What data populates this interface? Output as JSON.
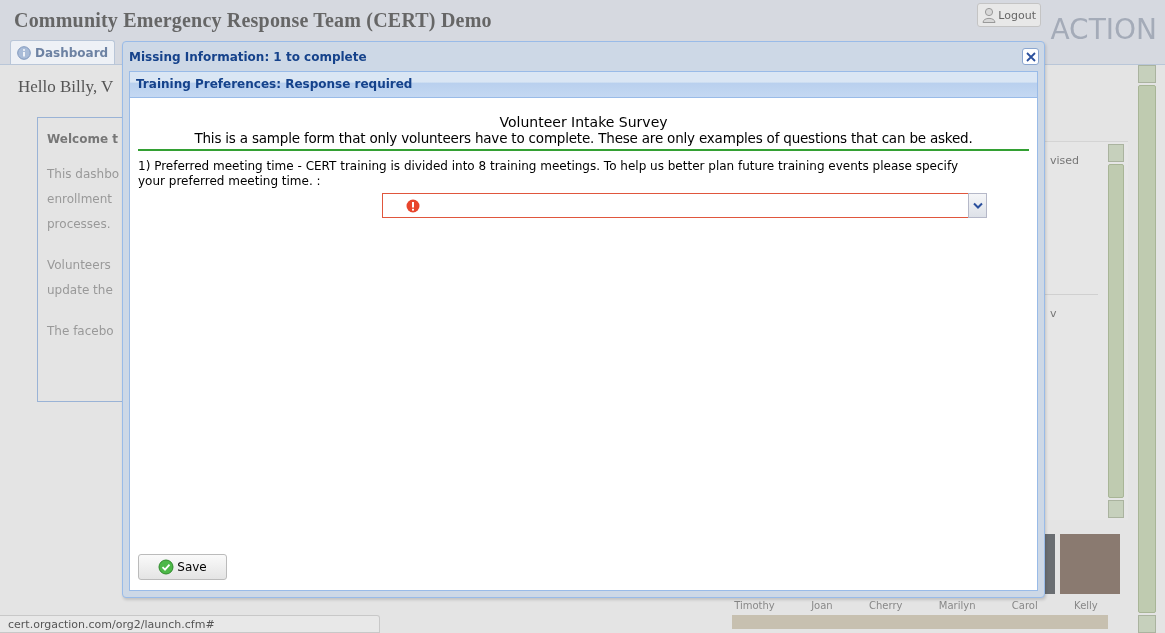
{
  "app": {
    "title": "Community Emergency Response Team (CERT) Demo",
    "logout": "Logout",
    "logo": "ACTION"
  },
  "tabs": [
    {
      "label": "Dashboard",
      "selected": true
    }
  ],
  "greeting": "Hello Billy, V",
  "welcome_card": {
    "heading": "Welcome t",
    "paragraphs": [
      [
        "This dashbo",
        "enrollment",
        "processes."
      ],
      [
        "Volunteers",
        "update the"
      ],
      [
        "The facebo"
      ]
    ]
  },
  "side_panel": {
    "items": [
      "vised",
      "v"
    ]
  },
  "people": [
    "Timothy",
    "Joan",
    "Cherry",
    "Marilyn",
    "Carol",
    "Kelly"
  ],
  "status_bar": "cert.orgaction.com/org2/launch.cfm#",
  "dialog": {
    "title": "Missing Information: 1 to complete",
    "section": "Training Preferences: Response required",
    "form_title": "Volunteer Intake Survey",
    "form_subtitle": "This is a sample form that only volunteers have to complete. These are only examples of questions that can be asked.",
    "questions": [
      {
        "label": "1) Preferred meeting time - CERT training is divided into 8 training meetings. To help us better plan future training events please specify your preferred meeting time. :",
        "invalid": true
      }
    ],
    "save": "Save"
  }
}
